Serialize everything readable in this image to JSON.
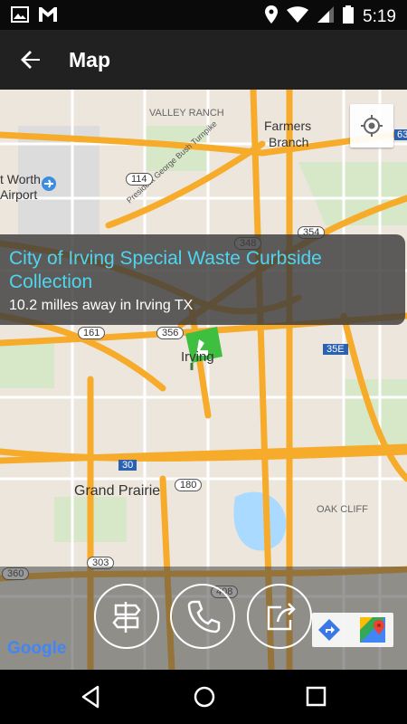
{
  "status_bar": {
    "time": "5:19",
    "left_icons": [
      "image-icon",
      "gmail-icon"
    ],
    "right_icons": [
      "location-icon",
      "wifi-icon",
      "signal-icon",
      "battery-icon"
    ]
  },
  "app_bar": {
    "title": "Map",
    "back_icon": "arrow-back-icon"
  },
  "map": {
    "labels": {
      "valley_ranch": "VALLEY RANCH",
      "farmers": "Farmers",
      "branch": "Branch",
      "fort_worth": "t Worth",
      "airport": "Airport",
      "pgbt": "President George Bush Turnpike",
      "irving": "Irving",
      "grand_prairie": "Grand Prairie",
      "oak_cliff": "OAK CLIFF"
    },
    "shields": {
      "s114": "114",
      "s348": "348",
      "s354": "354",
      "s161": "161",
      "s356": "356",
      "s35e": "35E",
      "s30": "30",
      "s180": "180",
      "s303": "303",
      "s360": "360",
      "s408": "408",
      "s63": "63"
    },
    "attribution": "Google",
    "marker": "recycle-marker-icon",
    "my_location_icon": "my-location-icon"
  },
  "info_window": {
    "name": "City of Irving Special Waste Curbside Collection",
    "distance": "10.2 milles away in Irving TX"
  },
  "actions": {
    "directions_icon": "directions-signpost-icon",
    "call_icon": "phone-icon",
    "share_icon": "share-icon",
    "nav_icon": "navigation-icon",
    "maps_icon": "google-maps-icon"
  },
  "colors": {
    "appbar": "#212121",
    "highway": "#f7ab2a",
    "info_title": "#4fd4f0",
    "map_bg": "#ece6dc"
  },
  "nav_bar": {
    "back": "back-triangle-icon",
    "home": "home-circle-icon",
    "recents": "recents-square-icon"
  }
}
